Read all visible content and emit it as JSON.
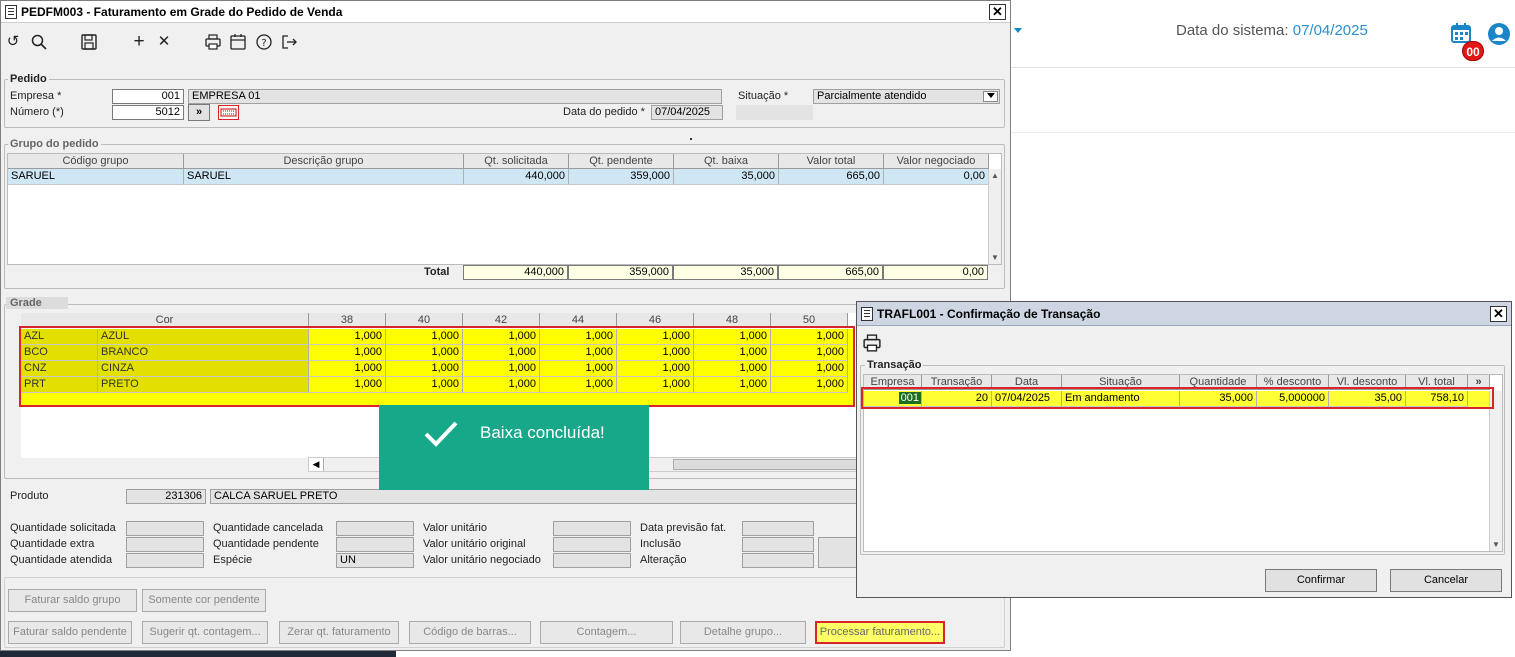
{
  "bg": {
    "date_label": "Data do sistema:",
    "date_value": "07/04/2025",
    "badge": "00"
  },
  "main": {
    "title": "PEDFM003 - Faturamento em Grade do Pedido de Venda",
    "pedido": {
      "legend": "Pedido",
      "empresa_label": "Empresa *",
      "empresa_code": "001",
      "empresa_name": "EMPRESA 01",
      "numero_label": "Número (*)",
      "numero": "5012",
      "situacao_label": "Situação *",
      "situacao": "Parcialmente atendido",
      "data_label": "Data do pedido *",
      "data": "07/04/2025",
      "nav_btn": "»"
    },
    "grupo": {
      "legend": "Grupo do pedido",
      "headers": [
        "Código grupo",
        "Descrição grupo",
        "Qt. solicitada",
        "Qt. pendente",
        "Qt. baixa",
        "Valor total",
        "Valor  negociado"
      ],
      "row": [
        "SARUEL",
        "SARUEL",
        "440,000",
        "359,000",
        "35,000",
        "665,00",
        "0,00"
      ],
      "total_label": "Total",
      "totals": [
        "440,000",
        "359,000",
        "35,000",
        "665,00",
        "0,00"
      ]
    },
    "grade": {
      "legend": "Grade",
      "headers": [
        "Cor",
        "38",
        "40",
        "42",
        "44",
        "46",
        "48",
        "50"
      ],
      "rows": [
        {
          "code": "AZL",
          "name": "AZUL",
          "vals": [
            "1,000",
            "1,000",
            "1,000",
            "1,000",
            "1,000",
            "1,000",
            "1,000"
          ]
        },
        {
          "code": "BCO",
          "name": "BRANCO",
          "vals": [
            "1,000",
            "1,000",
            "1,000",
            "1,000",
            "1,000",
            "1,000",
            "1,000"
          ]
        },
        {
          "code": "CNZ",
          "name": "CINZA",
          "vals": [
            "1,000",
            "1,000",
            "1,000",
            "1,000",
            "1,000",
            "1,000",
            "1,000"
          ]
        },
        {
          "code": "PRT",
          "name": "PRETO",
          "vals": [
            "1,000",
            "1,000",
            "1,000",
            "1,000",
            "1,000",
            "1,000",
            "1,000"
          ]
        }
      ]
    },
    "produto": {
      "label": "Produto",
      "code": "231306",
      "name": "CALCA SARUEL PRETO"
    },
    "info": {
      "qt_solicitada": "Quantidade solicitada",
      "qt_extra": "Quantidade extra",
      "qt_atendida": "Quantidade atendida",
      "qt_cancelada": "Quantidade cancelada",
      "qt_pendente": "Quantidade pendente",
      "especie": "Espécie",
      "especie_val": "UN",
      "vl_unitario": "Valor unitário",
      "vl_unit_original": "Valor unitário original",
      "vl_unit_negociado": "Valor unitário negociado",
      "data_prev": "Data previsão fat.",
      "inclusao": "Inclusão",
      "alteracao": "Alteração"
    },
    "buttons": {
      "faturar_saldo_grupo": "Faturar saldo grupo",
      "somente_cor": "Somente cor pendente",
      "faturar_saldo_pend": "Faturar saldo pendente",
      "sugerir": "Sugerir qt. contagem...",
      "zerar": "Zerar qt. faturamento",
      "codigo_barras": "Código de barras...",
      "contagem": "Contagem...",
      "detalhe": "Detalhe grupo...",
      "processar": "Processar faturamento..."
    }
  },
  "toast": {
    "message": "Baixa concluída!"
  },
  "dialog": {
    "title": "TRAFL001 - Confirmação de Transação",
    "legend": "Transação",
    "headers": [
      "Empresa",
      "Transação",
      "Data",
      "Situação",
      "Quantidade",
      "% desconto",
      "Vl. desconto",
      "Vl. total",
      "»"
    ],
    "row": [
      "001",
      "20",
      "07/04/2025",
      "Em andamento",
      "35,000",
      "5,000000",
      "35,00",
      "758,10"
    ],
    "confirm": "Confirmar",
    "cancel": "Cancelar"
  }
}
